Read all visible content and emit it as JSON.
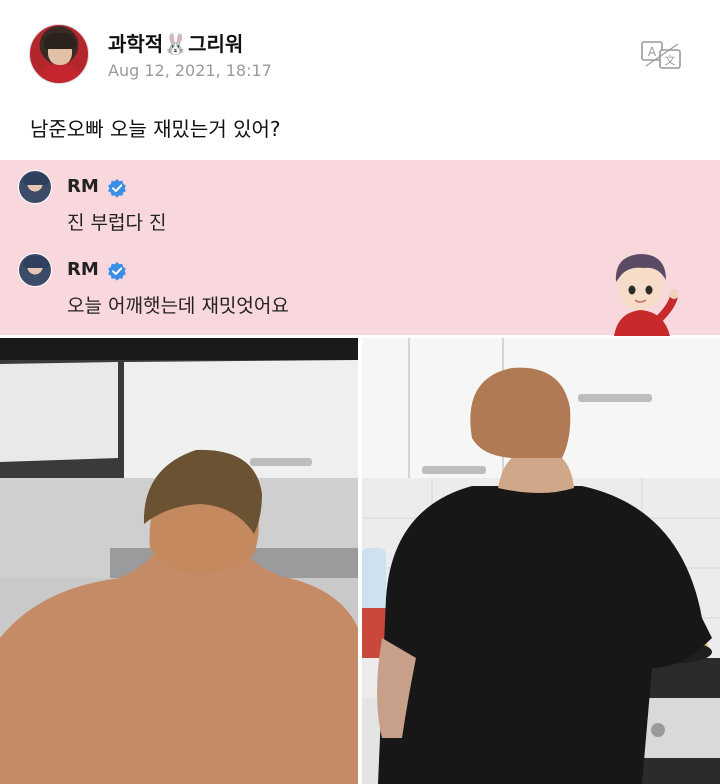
{
  "post": {
    "username_part1": "과학적",
    "username_emoji": "🐰",
    "username_part2": "그리워",
    "timestamp": "Aug 12, 2021, 18:17",
    "text": "남준오빠 오늘 재밌는거 있어?",
    "translate_icon": "translate-icon"
  },
  "replies": [
    {
      "name": "RM",
      "verified_icon": "verified-badge-icon",
      "text": "진 부럽다 진"
    },
    {
      "name": "RM",
      "verified_icon": "verified-badge-icon",
      "text": "오늘 어깨햇는데 재밋엇어요"
    }
  ],
  "colors": {
    "reply_background": "#f8d7dd",
    "verified_blue": "#3a8ee6",
    "timestamp_gray": "#9a9a9a"
  },
  "images": [
    {
      "name": "photo-shirtless-back-kitchen"
    },
    {
      "name": "photo-black-tshirt-cooking"
    }
  ]
}
